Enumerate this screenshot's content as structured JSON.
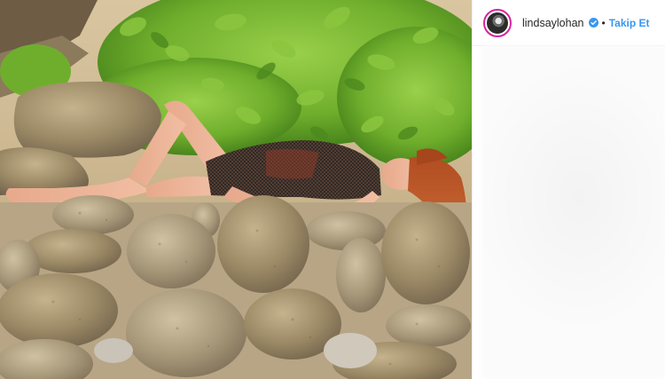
{
  "post": {
    "username": "lindsaylohan",
    "separator": "•",
    "follow_label": "Takip Et",
    "verified_icon": "verified-badge-icon",
    "accent_color": "#3897f0"
  }
}
